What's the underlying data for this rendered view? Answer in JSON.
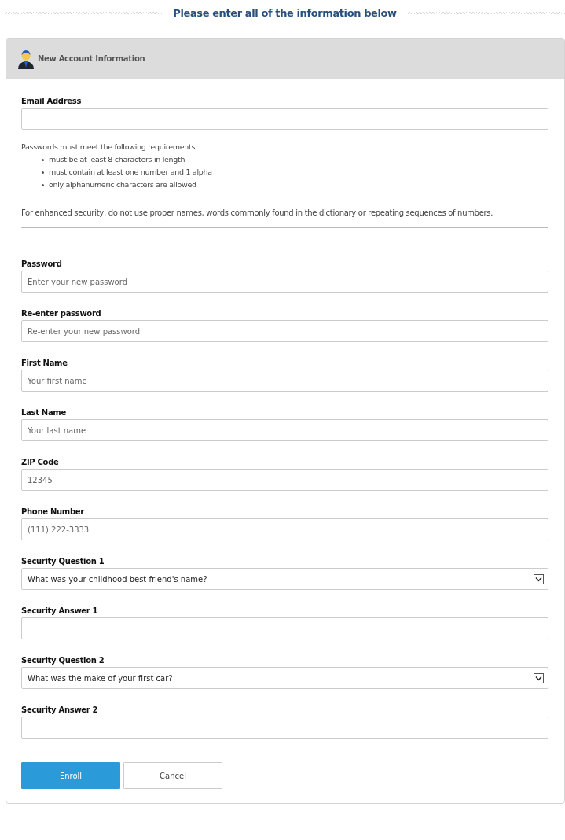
{
  "heading": "Please enter all of the information below",
  "panel": {
    "title": "New Account Information"
  },
  "email": {
    "label": "Email Address",
    "kind": "input"
  },
  "requirements": {
    "intro": "Passwords must meet the following requirements:",
    "items": [
      "must be at least 8 characters in length",
      "must contain at least one number and 1 alpha",
      "only alphanumeric characters are allowed"
    ],
    "note": "For enhanced security, do not use proper names, words commonly found in the dictionary or repeating sequences of numbers."
  },
  "fields": [
    {
      "label": "Password",
      "kind": "input",
      "placeholder": "Enter your new password"
    },
    {
      "label": "Re-enter password",
      "kind": "input",
      "placeholder": "Re-enter your new password"
    },
    {
      "label": "First Name",
      "kind": "input",
      "placeholder": "Your first name"
    },
    {
      "label": "Last Name",
      "kind": "input",
      "placeholder": "Your last name"
    },
    {
      "label": "ZIP Code",
      "kind": "input",
      "placeholder": "12345"
    },
    {
      "label": "Phone Number",
      "kind": "input",
      "placeholder": "(111) 222-3333"
    },
    {
      "label": "Security Question 1",
      "kind": "select",
      "value": "What was your childhood best friend's name?"
    },
    {
      "label": "Security Answer 1",
      "kind": "input"
    },
    {
      "label": "Security Question 2",
      "kind": "select",
      "value": "What was the make of your first car?"
    },
    {
      "label": "Security Answer 2",
      "kind": "input"
    }
  ],
  "buttons": [
    {
      "label": "Enroll",
      "kind": "primary"
    },
    {
      "label": "Cancel",
      "kind": "secondary"
    }
  ]
}
